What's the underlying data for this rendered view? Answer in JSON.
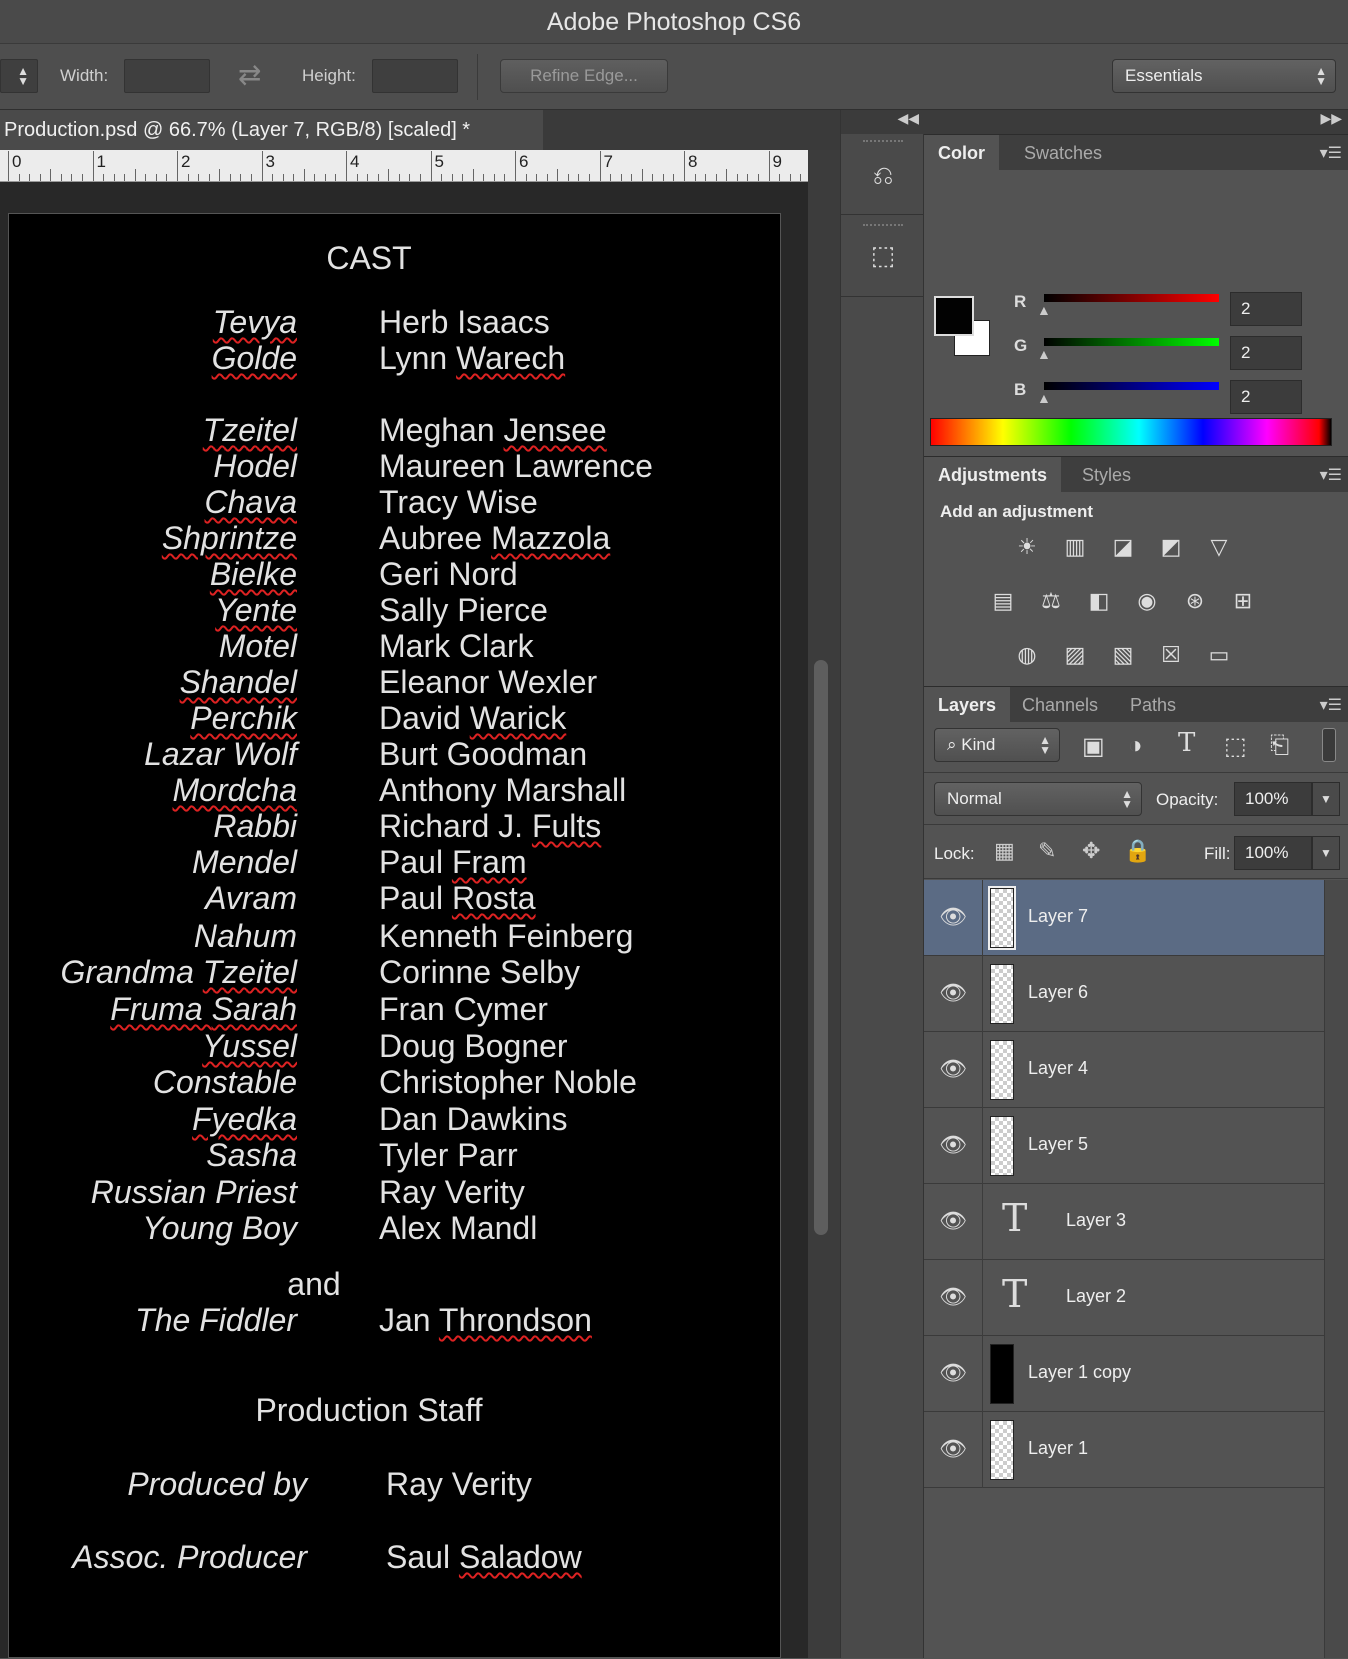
{
  "app": {
    "title": "Adobe Photoshop CS6"
  },
  "options": {
    "width_label": "Width:",
    "height_label": "Height:",
    "refine_edge": "Refine Edge...",
    "workspace": "Essentials",
    "swap_icon": "swap-arrows-icon"
  },
  "document": {
    "tab_title": "Production.psd @ 66.7% (Layer 7, RGB/8) [scaled] *",
    "ruler_numbers": [
      "0",
      "1",
      "2",
      "3",
      "4",
      "5",
      "6",
      "7",
      "8",
      "9"
    ]
  },
  "credits": {
    "cast_heading": "CAST",
    "cast": [
      {
        "role": "Tevya",
        "name": "Herb Isaacs"
      },
      {
        "role": "Golde",
        "name": "Lynn Warech"
      },
      {
        "role": "Tzeitel",
        "name": "Meghan Jensee"
      },
      {
        "role": "Hodel",
        "name": "Maureen Lawrence"
      },
      {
        "role": "Chava",
        "name": "Tracy Wise"
      },
      {
        "role": "Shprintze",
        "name": "Aubree Mazzola"
      },
      {
        "role": "Bielke",
        "name": "Geri Nord"
      },
      {
        "role": "Yente",
        "name": "Sally Pierce"
      },
      {
        "role": "Motel",
        "name": "Mark Clark"
      },
      {
        "role": "Shandel",
        "name": "Eleanor Wexler"
      },
      {
        "role": "Perchik",
        "name": "David Warick"
      },
      {
        "role": "Lazar Wolf",
        "name": "Burt Goodman"
      },
      {
        "role": "Mordcha",
        "name": "Anthony Marshall"
      },
      {
        "role": "Rabbi",
        "name": "Richard J. Fults"
      },
      {
        "role": "Mendel",
        "name": "Paul Fram"
      },
      {
        "role": "Avram",
        "name": "Paul Rosta"
      },
      {
        "role": "Nahum",
        "name": "Kenneth Feinberg"
      },
      {
        "role": "Grandma Tzeitel",
        "name": "Corinne Selby"
      },
      {
        "role": "Fruma Sarah",
        "name": "Fran Cymer"
      },
      {
        "role": "Yussel",
        "name": "Doug Bogner"
      },
      {
        "role": "Constable",
        "name": "Christopher Noble"
      },
      {
        "role": "Fyedka",
        "name": "Dan Dawkins"
      },
      {
        "role": "Sasha",
        "name": "Tyler Parr"
      },
      {
        "role": "Russian Priest",
        "name": "Ray Verity"
      },
      {
        "role": "Young Boy",
        "name": "Alex Mandl"
      }
    ],
    "and_text": "and",
    "fiddler": {
      "role": "The Fiddler",
      "name": "Jan Throndson"
    },
    "staff_heading": "Production Staff",
    "staff": [
      {
        "role": "Produced  by",
        "name": "Ray Verity"
      },
      {
        "role": "Assoc. Producer",
        "name": "Saul Saladow"
      }
    ]
  },
  "color_panel": {
    "tabs": [
      "Color",
      "Swatches"
    ],
    "r_label": "R",
    "g_label": "G",
    "b_label": "B",
    "r": "2",
    "g": "2",
    "b": "2",
    "foreground": "#020202",
    "background": "#ffffff"
  },
  "adjustments_panel": {
    "tabs": [
      "Adjustments",
      "Styles"
    ],
    "heading": "Add an adjustment",
    "icons": [
      "brightness-icon",
      "levels-icon",
      "curves-icon",
      "exposure-icon",
      "vibrance-icon",
      "hue-saturation-icon",
      "color-balance-icon",
      "black-white-icon",
      "photo-filter-icon",
      "channel-mixer-icon",
      "color-lookup-icon",
      "invert-icon",
      "posterize-icon",
      "threshold-icon",
      "selective-color-icon",
      "gradient-map-icon"
    ]
  },
  "layers_panel": {
    "tabs": [
      "Layers",
      "Channels",
      "Paths"
    ],
    "filter_kind": "Kind",
    "blend_mode": "Normal",
    "opacity_label": "Opacity:",
    "opacity": "100%",
    "lock_label": "Lock:",
    "fill_label": "Fill:",
    "fill": "100%",
    "layers": [
      {
        "name": "Layer 7",
        "type": "pixel",
        "selected": true
      },
      {
        "name": "Layer 6",
        "type": "pixel",
        "selected": false
      },
      {
        "name": "Layer 4",
        "type": "pixel",
        "selected": false
      },
      {
        "name": "Layer 5",
        "type": "pixel",
        "selected": false
      },
      {
        "name": "Layer 3",
        "type": "text",
        "selected": false
      },
      {
        "name": "Layer 2",
        "type": "text",
        "selected": false
      },
      {
        "name": "Layer 1 copy",
        "type": "fill",
        "selected": false
      },
      {
        "name": "Layer 1",
        "type": "pixel",
        "selected": false
      }
    ]
  },
  "colors": {
    "selection": "#5b6b84",
    "squiggle": "#dd2222"
  }
}
